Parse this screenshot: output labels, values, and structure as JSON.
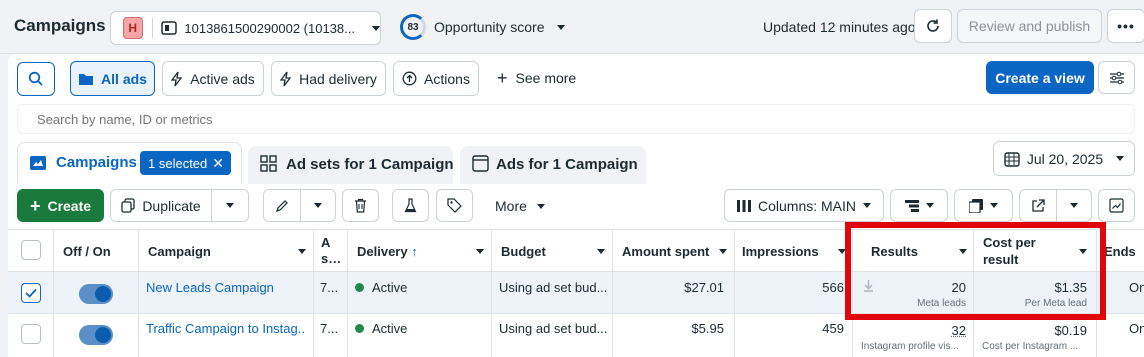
{
  "header": {
    "title": "Campaigns",
    "account_badge": "H",
    "account_name": "1013861500290002 (10138...",
    "opportunity_score": "83",
    "opportunity_label": "Opportunity score",
    "updated_text": "Updated 12 minutes ago",
    "review_label": "Review and publish"
  },
  "filters": {
    "all_ads": "All ads",
    "active_ads": "Active ads",
    "had_delivery": "Had delivery",
    "actions": "Actions",
    "see_more": "See more",
    "create_view": "Create a view"
  },
  "search": {
    "placeholder": "Search by name, ID or metrics"
  },
  "tabs": {
    "campaigns": "Campaigns",
    "selected_badge": "1 selected",
    "ad_sets": "Ad sets for 1 Campaign",
    "ads": "Ads for 1 Campaign",
    "date": "Jul 20, 2025"
  },
  "toolbar": {
    "create": "Create",
    "duplicate": "Duplicate",
    "more": "More",
    "columns": "Columns: MAIN"
  },
  "table": {
    "headers": {
      "off_on": "Off / On",
      "campaign": "Campaign",
      "attr_line1": "A",
      "attr_line2": "s",
      "delivery": "Delivery",
      "budget": "Budget",
      "amount_spent": "Amount spent",
      "impressions": "Impressions",
      "results": "Results",
      "cost_line1": "Cost per",
      "cost_line2": "result",
      "ends": "Ends"
    },
    "rows": [
      {
        "campaign": "New Leads Campaign",
        "attr": "7...",
        "delivery": "Active",
        "budget": "Using ad set bud...",
        "amount_spent": "$27.01",
        "impressions": "566",
        "results": "20",
        "results_sub": "Meta leads",
        "cost": "$1.35",
        "cost_sub": "Per Meta lead",
        "ends": "On"
      },
      {
        "campaign": "Traffic Campaign to Instag...",
        "attr": "7...",
        "delivery": "Active",
        "budget": "Using ad set bud...",
        "amount_spent": "$5.95",
        "impressions": "459",
        "results": "32",
        "results_sub": "Instagram profile vis...",
        "cost": "$0.19",
        "cost_sub": "Cost per Instagram ...",
        "ends": "On"
      }
    ]
  },
  "colors": {
    "primary": "#0a66c2",
    "create_green": "#1a7a3e",
    "active_dot": "#1f8a4c",
    "highlight_red": "#e0060b",
    "badge_pink": "#f5a6a6"
  }
}
